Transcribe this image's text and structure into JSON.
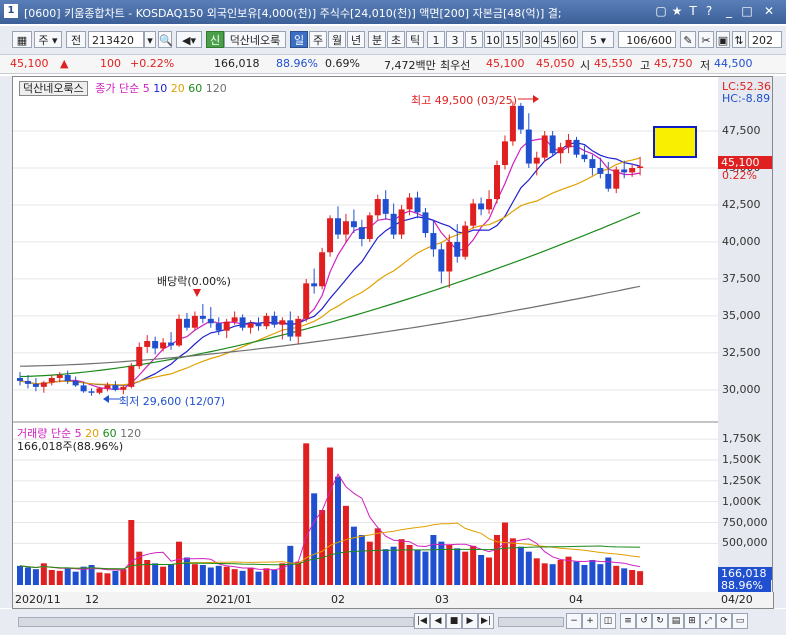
{
  "window": {
    "number": "1",
    "title": "[0600] 키움종합차트 - KOSDAQ150 외국인보유[4,000(천)] 주식수[24,010(천)] 액면[200] 자본금[48(억)] 결;"
  },
  "toolbar": {
    "period": "주",
    "prev": "전",
    "code": "213420",
    "new_badge": "신",
    "stock_name": "덕산네오룩",
    "tabs": [
      "일",
      "주",
      "월",
      "년",
      "분",
      "초",
      "틱"
    ],
    "active_tab": "일",
    "intervals": [
      "1",
      "3",
      "5",
      "10",
      "15",
      "30",
      "45",
      "60"
    ],
    "count_select": "5",
    "counter": "106/600",
    "date_field": "202"
  },
  "infobar": {
    "price": "45,100",
    "arrow": "▲",
    "change": "100",
    "change_pct": "+0.22%",
    "volume": "166,018",
    "vol_ratio": "88.96%",
    "turnover": "0.69%",
    "amount": "7,472백만",
    "best_label": "최우선",
    "ask": "45,100",
    "bid": "45,050",
    "open_label": "시",
    "open": "45,550",
    "high_label": "고",
    "high": "45,750",
    "low_label": "저",
    "low": "44,500"
  },
  "price_legend": {
    "name": "덕산네오룩스",
    "ma_label": "종가 단순",
    "ma_periods": [
      "5",
      "10",
      "20",
      "60",
      "120"
    ],
    "ma_colors": [
      "#d020c0",
      "#2020d0",
      "#e0a000",
      "#1a8a1a",
      "#707070"
    ]
  },
  "volume_legend": {
    "label": "거래량 단순",
    "periods": [
      "5",
      "20",
      "60",
      "120"
    ],
    "value": "166,018주(88.96%)"
  },
  "annotations": {
    "high": "최고 49,500 (03/25)",
    "low": "최저 29,600 (12/07)",
    "dividend": "배당락(0.00%)"
  },
  "axis": {
    "lc": "LC:52.36",
    "hc": "HC:-8.89",
    "price_ticks": [
      "47,500",
      "45,000",
      "42,500",
      "40,000",
      "37,500",
      "35,000",
      "32,500",
      "30,000"
    ],
    "current_price": "45,100",
    "current_pct": "0.22%",
    "volume_ticks": [
      "1,750K",
      "1,500K",
      "1,250K",
      "1,000K",
      "750,000",
      "500,000"
    ],
    "current_volume": "166,018",
    "current_vol_pct": "88.96%",
    "x_labels": [
      "2020/11",
      "12",
      "2021/01",
      "02",
      "03",
      "04",
      "04/20"
    ]
  },
  "colors": {
    "up": "#e02020",
    "down": "#2050d0",
    "box_fill": "#f8f000",
    "box_border": "#1020c0"
  },
  "chart_data": {
    "type": "candlestick",
    "ylim": [
      28500,
      49800
    ],
    "candles": [
      [
        30800,
        31200,
        30300,
        30600
      ],
      [
        30600,
        31000,
        30100,
        30400
      ],
      [
        30400,
        30800,
        29900,
        30200
      ],
      [
        30200,
        30600,
        29800,
        30500
      ],
      [
        30500,
        31000,
        30300,
        30800
      ],
      [
        30800,
        31200,
        30500,
        31000
      ],
      [
        31000,
        31300,
        30400,
        30600
      ],
      [
        30600,
        30900,
        30200,
        30300
      ],
      [
        30300,
        30500,
        29800,
        29900
      ],
      [
        29900,
        30100,
        29600,
        29800
      ],
      [
        29800,
        30200,
        29700,
        30100
      ],
      [
        30100,
        30500,
        29900,
        30300
      ],
      [
        30300,
        30600,
        29900,
        30000
      ],
      [
        30000,
        30300,
        29700,
        30200
      ],
      [
        30200,
        31800,
        30100,
        31600
      ],
      [
        31600,
        33200,
        31400,
        32900
      ],
      [
        32900,
        33700,
        32500,
        33300
      ],
      [
        33300,
        33600,
        32400,
        32800
      ],
      [
        32800,
        33500,
        32600,
        33200
      ],
      [
        33200,
        33900,
        32700,
        33000
      ],
      [
        33000,
        35100,
        32900,
        34800
      ],
      [
        34800,
        35200,
        34000,
        34200
      ],
      [
        34200,
        35300,
        34000,
        35000
      ],
      [
        35000,
        35800,
        34500,
        34800
      ],
      [
        34800,
        35600,
        34200,
        34500
      ],
      [
        34500,
        34900,
        33700,
        34000
      ],
      [
        34000,
        34800,
        33500,
        34600
      ],
      [
        34600,
        35300,
        34400,
        34900
      ],
      [
        34900,
        35100,
        34000,
        34200
      ],
      [
        34200,
        34700,
        33800,
        34500
      ],
      [
        34500,
        34900,
        34000,
        34300
      ],
      [
        34300,
        35200,
        34100,
        35000
      ],
      [
        35000,
        35300,
        34200,
        34400
      ],
      [
        34400,
        34900,
        33400,
        34700
      ],
      [
        34700,
        35300,
        33300,
        33600
      ],
      [
        33600,
        35000,
        33100,
        34800
      ],
      [
        34800,
        37500,
        34600,
        37200
      ],
      [
        37200,
        38200,
        36500,
        37000
      ],
      [
        37000,
        39600,
        36800,
        39300
      ],
      [
        39300,
        41800,
        39000,
        41600
      ],
      [
        41600,
        42400,
        40200,
        40500
      ],
      [
        40500,
        41900,
        40000,
        41400
      ],
      [
        41400,
        42200,
        40600,
        41000
      ],
      [
        41000,
        41500,
        39700,
        40200
      ],
      [
        40200,
        42000,
        40000,
        41800
      ],
      [
        41800,
        43200,
        41500,
        42900
      ],
      [
        42900,
        43500,
        41500,
        41900
      ],
      [
        41900,
        42600,
        40200,
        40500
      ],
      [
        40500,
        42500,
        40200,
        42200
      ],
      [
        42200,
        43300,
        41800,
        43000
      ],
      [
        43000,
        43400,
        41600,
        42000
      ],
      [
        42000,
        42300,
        40300,
        40600
      ],
      [
        40600,
        41500,
        39000,
        39500
      ],
      [
        39500,
        39900,
        37200,
        38000
      ],
      [
        38000,
        40500,
        36900,
        40000
      ],
      [
        40000,
        41200,
        38600,
        39000
      ],
      [
        39000,
        41400,
        38800,
        41100
      ],
      [
        41100,
        42900,
        40900,
        42600
      ],
      [
        42600,
        43000,
        41800,
        42200
      ],
      [
        42200,
        43500,
        41900,
        42900
      ],
      [
        42900,
        45500,
        42600,
        45200
      ],
      [
        45200,
        47200,
        44900,
        46800
      ],
      [
        46800,
        49500,
        46500,
        49200
      ],
      [
        49200,
        49400,
        47300,
        47600
      ],
      [
        47600,
        48700,
        45000,
        45300
      ],
      [
        45300,
        46100,
        44500,
        45700
      ],
      [
        45700,
        47500,
        45400,
        47200
      ],
      [
        47200,
        47500,
        45800,
        46000
      ],
      [
        46000,
        46700,
        45300,
        46400
      ],
      [
        46400,
        47300,
        46000,
        46900
      ],
      [
        46900,
        47100,
        45700,
        45900
      ],
      [
        45900,
        46500,
        45400,
        45600
      ],
      [
        45600,
        45900,
        44500,
        45000
      ],
      [
        45000,
        45700,
        44300,
        44600
      ],
      [
        44600,
        45400,
        43400,
        43600
      ],
      [
        43600,
        45100,
        43300,
        44900
      ],
      [
        44900,
        45500,
        44300,
        44700
      ],
      [
        44700,
        45200,
        44400,
        45000
      ],
      [
        45000,
        45750,
        44500,
        45100
      ]
    ],
    "ma_periods": [
      5,
      10,
      20,
      60,
      120
    ],
    "volume": [
      230000,
      210000,
      190000,
      260000,
      180000,
      170000,
      200000,
      160000,
      220000,
      240000,
      150000,
      140000,
      170000,
      190000,
      780000,
      400000,
      300000,
      260000,
      220000,
      250000,
      520000,
      330000,
      250000,
      240000,
      210000,
      230000,
      220000,
      190000,
      170000,
      210000,
      160000,
      200000,
      180000,
      260000,
      470000,
      280000,
      1700000,
      1100000,
      900000,
      1650000,
      1300000,
      950000,
      700000,
      600000,
      520000,
      680000,
      430000,
      460000,
      550000,
      480000,
      420000,
      400000,
      600000,
      520000,
      480000,
      440000,
      400000,
      470000,
      360000,
      330000,
      600000,
      750000,
      560000,
      460000,
      400000,
      320000,
      260000,
      250000,
      300000,
      340000,
      280000,
      240000,
      300000,
      250000,
      330000,
      230000,
      200000,
      180000,
      166018
    ]
  }
}
